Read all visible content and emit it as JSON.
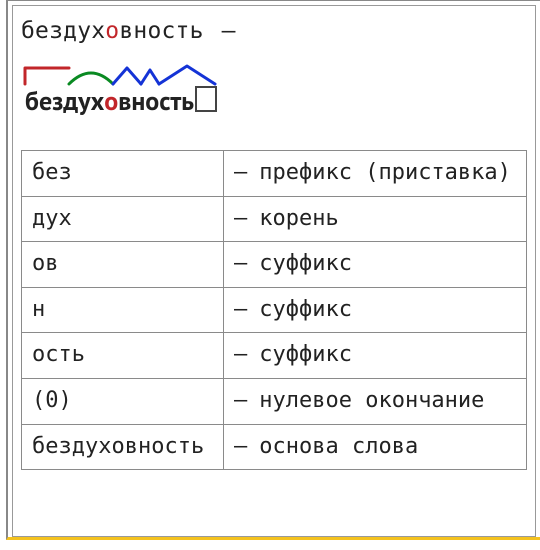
{
  "headline": {
    "word_pre": "бездух",
    "word_accent": "о",
    "word_post": "вность",
    "dash": "—"
  },
  "diagram_word": {
    "pre1": "бездух",
    "accent": "о",
    "post1": "вность"
  },
  "table": {
    "rows": [
      {
        "left": "без",
        "right": "префикс (приставка)"
      },
      {
        "left": "дух",
        "right": "корень"
      },
      {
        "left": "ов",
        "right": "суффикс"
      },
      {
        "left": "н",
        "right": "суффикс"
      },
      {
        "left": "ость",
        "right": "суффикс"
      },
      {
        "left": "(0)",
        "right": "нулевое окончание"
      },
      {
        "left": "бездуховность",
        "right": "основа слова"
      }
    ],
    "dash": "—"
  }
}
